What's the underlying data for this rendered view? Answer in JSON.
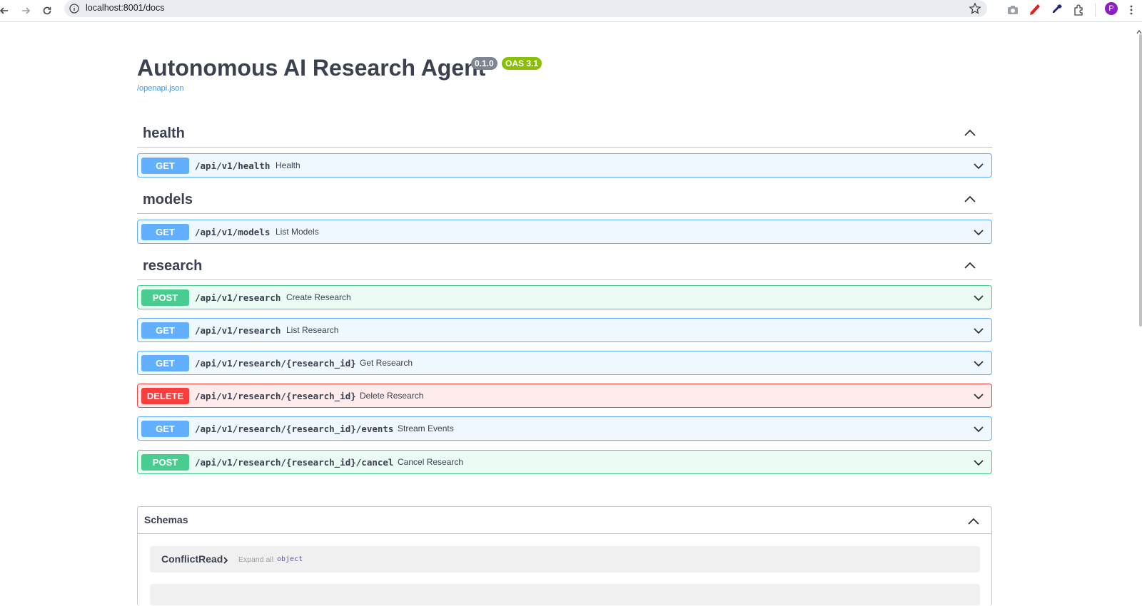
{
  "browser": {
    "url": "localhost:8001/docs",
    "avatar_letter": "P"
  },
  "api": {
    "title": "Autonomous AI Research Agent",
    "version_badge": "0.1.0",
    "oas_badge": "OAS 3.1",
    "spec_link": "/openapi.json"
  },
  "tags": [
    {
      "name": "health",
      "operations": [
        {
          "method": "GET",
          "path": "/api/v1/health",
          "summary": "Health"
        }
      ]
    },
    {
      "name": "models",
      "operations": [
        {
          "method": "GET",
          "path": "/api/v1/models",
          "summary": "List Models"
        }
      ]
    },
    {
      "name": "research",
      "operations": [
        {
          "method": "POST",
          "path": "/api/v1/research",
          "summary": "Create Research"
        },
        {
          "method": "GET",
          "path": "/api/v1/research",
          "summary": "List Research"
        },
        {
          "method": "GET",
          "path": "/api/v1/research/{research_id}",
          "summary": "Get Research"
        },
        {
          "method": "DELETE",
          "path": "/api/v1/research/{research_id}",
          "summary": "Delete Research"
        },
        {
          "method": "GET",
          "path": "/api/v1/research/{research_id}/events",
          "summary": "Stream Events"
        },
        {
          "method": "POST",
          "path": "/api/v1/research/{research_id}/cancel",
          "summary": "Cancel Research"
        }
      ]
    }
  ],
  "schemas": {
    "title": "Schemas",
    "items": [
      {
        "name": "ConflictRead",
        "expand_label": "Expand all",
        "type": "object"
      }
    ]
  },
  "colors": {
    "get": "#61affe",
    "post": "#49cc90",
    "delete": "#f93e3e",
    "version_badge": "#7d8492",
    "oas_badge": "#89bf04"
  }
}
